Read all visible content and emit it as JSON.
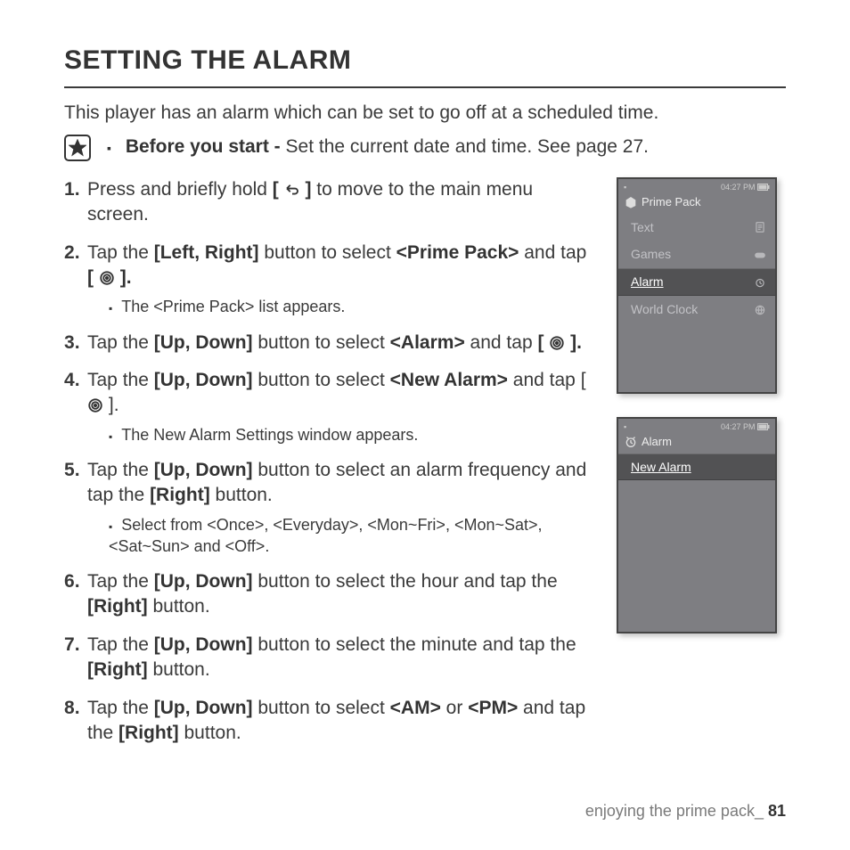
{
  "heading": "SETTING THE ALARM",
  "intro": "This player has an alarm which can be set to go off at a scheduled time.",
  "note_prefix": "Before you start - ",
  "note_body": "Set the current date and time. See page 27.",
  "steps": {
    "s1a": "Press and briefly hold ",
    "s1b": " to move to the main menu screen.",
    "s2a": "Tap the ",
    "s2_btn1": "[Left, Right]",
    "s2b": " button to select ",
    "s2_opt": "<Prime Pack>",
    "s2c": " and tap ",
    "s2_sub": "The <Prime Pack> list appears.",
    "s3a": "Tap the ",
    "s3_btn1": "[Up, Down]",
    "s3b": " button to select ",
    "s3_opt": "<Alarm>",
    "s3c": " and tap ",
    "s4a": "Tap the ",
    "s4_btn1": "[Up, Down]",
    "s4b": " button to select ",
    "s4_opt": "<New Alarm>",
    "s4c": " and tap ",
    "s4_sub": "The New Alarm Settings window appears.",
    "s5a": "Tap the ",
    "s5_btn1": "[Up, Down]",
    "s5b": " button to select an alarm frequency and tap the ",
    "s5_btn2": "[Right]",
    "s5c": " button.",
    "s5_sub": "Select from <Once>, <Everyday>, <Mon~Fri>, <Mon~Sat>, <Sat~Sun> and <Off>.",
    "s6a": "Tap the ",
    "s6_btn1": "[Up, Down]",
    "s6b": " button to select the hour and tap the ",
    "s6_btn2": "[Right]",
    "s6c": " button.",
    "s7a": "Tap the ",
    "s7_btn1": "[Up, Down]",
    "s7b": " button to select the minute and tap the ",
    "s7_btn2": "[Right]",
    "s7c": " button.",
    "s8a": "Tap the ",
    "s8_btn1": "[Up, Down]",
    "s8b": " button to select ",
    "s8_opt1": "<AM>",
    "s8c": " or ",
    "s8_opt2": "<PM>",
    "s8d": " and tap the ",
    "s8_btn2": "[Right]",
    "s8e": " button."
  },
  "brackets": {
    "open": "[",
    "close": "]",
    "period": "."
  },
  "device1": {
    "time": "04:27 PM",
    "title": "Prime Pack",
    "items": [
      "Text",
      "Games",
      "Alarm",
      "World Clock"
    ],
    "selected_index": 2
  },
  "device2": {
    "time": "04:27 PM",
    "title": "Alarm",
    "items": [
      "New Alarm"
    ],
    "selected_index": 0
  },
  "footer_text": "enjoying the prime pack_ ",
  "page_number": "81"
}
